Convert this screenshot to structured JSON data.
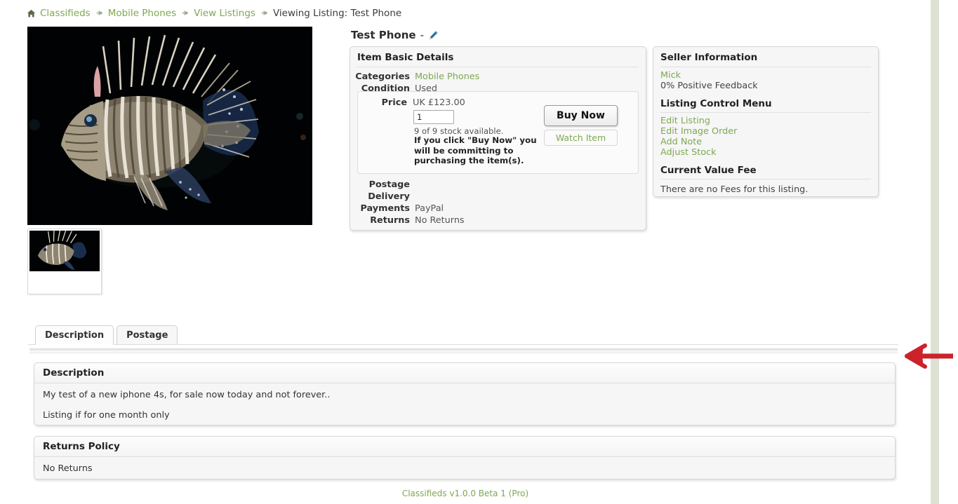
{
  "breadcrumb": {
    "home_icon": "home-icon",
    "separator": "➤",
    "items": [
      {
        "label": "Classifieds",
        "current": false
      },
      {
        "label": "Mobile Phones",
        "current": false
      },
      {
        "label": "View Listings",
        "current": false
      },
      {
        "label": "Viewing Listing: Test Phone",
        "current": true
      }
    ]
  },
  "listing": {
    "title": "Test Phone",
    "dash": "-",
    "edit_icon": "pencil-icon",
    "main_image_alt": "lionfish-photo",
    "thumbnail_alt": "lionfish-thumbnail"
  },
  "item_details": {
    "heading": "Item Basic Details",
    "rows": [
      {
        "label": "Categories",
        "value": "Mobile Phones",
        "link": true
      },
      {
        "label": "Condition",
        "value": "Used",
        "link": false
      }
    ],
    "price_label": "Price",
    "price_value": "UK £123.00",
    "quantity_value": "1",
    "stock_note": "9 of 9 stock available.",
    "buy_warning": "If you click \"Buy Now\" you will be committing to purchasing the item(s).",
    "buy_now_label": "Buy Now",
    "watch_item_label": "Watch Item",
    "bottom_rows": [
      {
        "label": "Postage",
        "value": ""
      },
      {
        "label": "Delivery",
        "value": ""
      },
      {
        "label": "Payments",
        "value": "PayPal"
      },
      {
        "label": "Returns",
        "value": "No Returns"
      }
    ]
  },
  "seller": {
    "heading": "Seller Information",
    "name": "Mick",
    "feedback": "0% Positive Feedback",
    "control_menu_heading": "Listing Control Menu",
    "menu_items": [
      {
        "label": "Edit Listing"
      },
      {
        "label": "Edit Image Order"
      },
      {
        "label": "Add Note"
      },
      {
        "label": "Adjust Stock"
      }
    ],
    "fee_heading": "Current Value Fee",
    "fee_text": "There are no Fees for this listing."
  },
  "tabs": [
    {
      "label": "Description",
      "active": true
    },
    {
      "label": "Postage",
      "active": false
    }
  ],
  "description_panel": {
    "heading": "Description",
    "paragraphs": [
      "My test of a new iphone 4s, for sale now today and not forever..",
      "Listing if for one month only"
    ]
  },
  "returns_panel": {
    "heading": "Returns Policy",
    "text": "No Returns"
  },
  "footer": {
    "text": "Classifieds v1.0.0 Beta 1 (Pro)"
  },
  "annotation": {
    "arrow": "left-arrow-annotation",
    "color": "#cc2229"
  },
  "colors": {
    "link_green": "#7da84f",
    "panel_bg": "#f6f6f6",
    "edge_band": "#dde1d2",
    "text_dark": "#333333"
  }
}
